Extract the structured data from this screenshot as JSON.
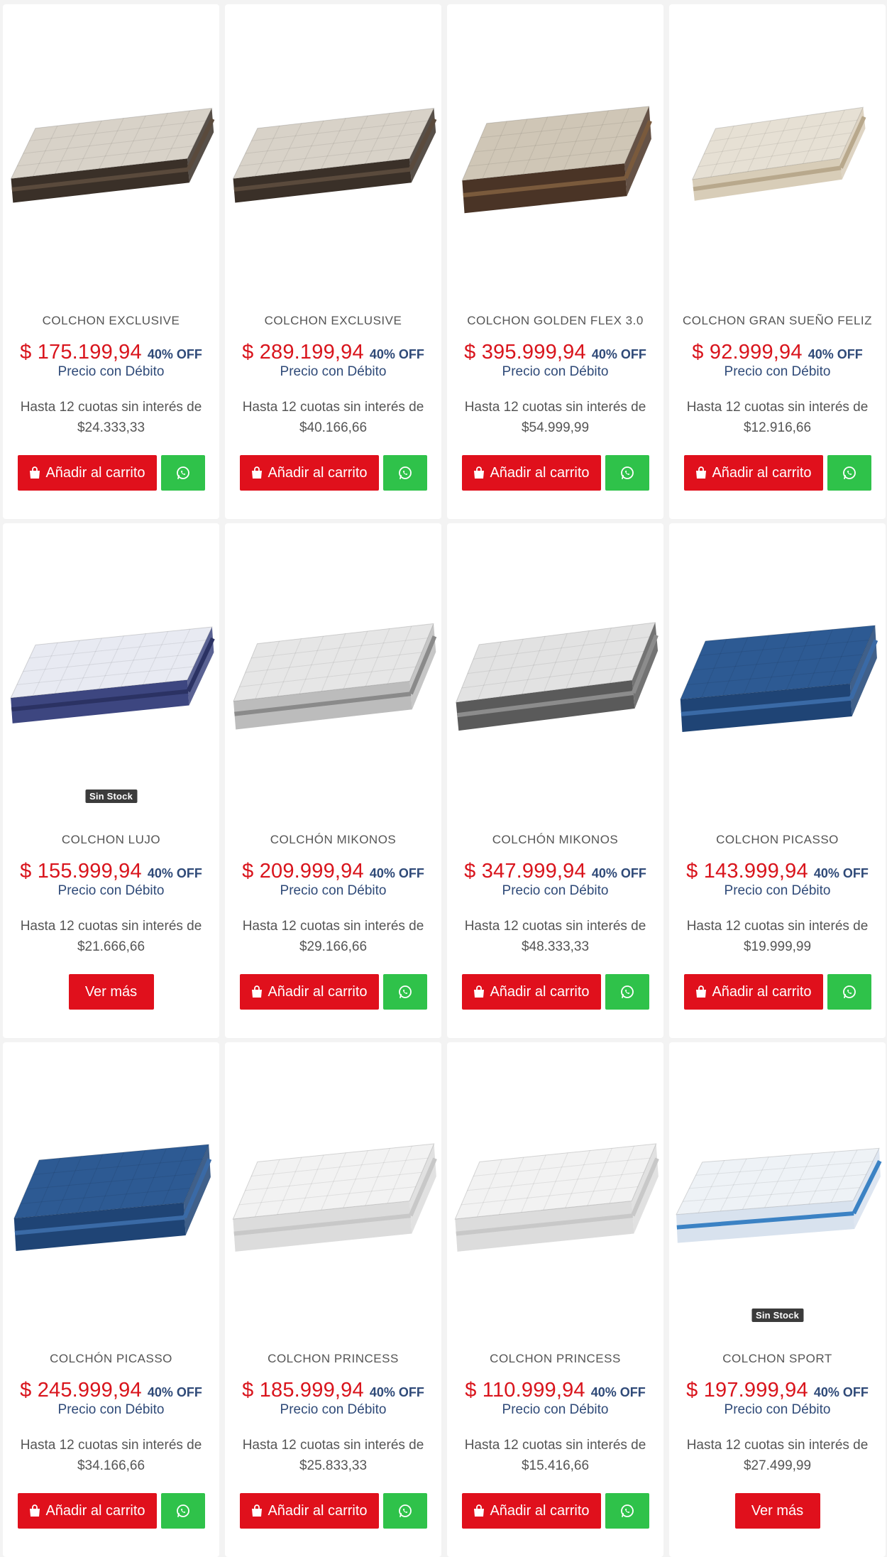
{
  "products": [
    {
      "name": "COLCHON EXCLUSIVE",
      "price": "$ 175.199,94",
      "off": "40% OFF",
      "debit": "Precio con Débito",
      "inst1": "Hasta 12 cuotas sin interés de",
      "inst2": "$24.333,33",
      "stock": "",
      "cart": "Añadir al carrito",
      "more": "",
      "img": "dark-quilted"
    },
    {
      "name": "COLCHON EXCLUSIVE",
      "price": "$ 289.199,94",
      "off": "40% OFF",
      "debit": "Precio con Débito",
      "inst1": "Hasta 12 cuotas sin interés de",
      "inst2": "$40.166,66",
      "stock": "",
      "cart": "Añadir al carrito",
      "more": "",
      "img": "dark-quilted"
    },
    {
      "name": "COLCHON GOLDEN FLEX 3.0",
      "price": "$ 395.999,94",
      "off": "40% OFF",
      "debit": "Precio con Débito",
      "inst1": "Hasta 12 cuotas sin interés de",
      "inst2": "$54.999,99",
      "stock": "",
      "cart": "Añadir al carrito",
      "more": "",
      "img": "brown-pillow"
    },
    {
      "name": "COLCHON GRAN SUEÑO FELIZ",
      "price": "$ 92.999,94",
      "off": "40% OFF",
      "debit": "Precio con Débito",
      "inst1": "Hasta 12 cuotas sin interés de",
      "inst2": "$12.916,66",
      "stock": "",
      "cart": "Añadir al carrito",
      "more": "",
      "img": "beige-single"
    },
    {
      "name": "COLCHON LUJO",
      "price": "$ 155.999,94",
      "off": "40% OFF",
      "debit": "Precio con Débito",
      "inst1": "Hasta 12 cuotas sin interés de",
      "inst2": "$21.666,66",
      "stock": "Sin Stock",
      "cart": "",
      "more": "Ver más",
      "img": "navy-white"
    },
    {
      "name": "COLCHÓN MIKONOS",
      "price": "$ 209.999,94",
      "off": "40% OFF",
      "debit": "Precio con Débito",
      "inst1": "Hasta 12 cuotas sin interés de",
      "inst2": "$29.166,66",
      "stock": "",
      "cart": "Añadir al carrito",
      "more": "",
      "img": "gray-stripe"
    },
    {
      "name": "COLCHÓN MIKONOS",
      "price": "$ 347.999,94",
      "off": "40% OFF",
      "debit": "Precio con Débito",
      "inst1": "Hasta 12 cuotas sin interés de",
      "inst2": "$48.333,33",
      "stock": "",
      "cart": "Añadir al carrito",
      "more": "",
      "img": "gray-dark-stripe"
    },
    {
      "name": "COLCHON PICASSO",
      "price": "$ 143.999,94",
      "off": "40% OFF",
      "debit": "Precio con Débito",
      "inst1": "Hasta 12 cuotas sin interés de",
      "inst2": "$19.999,99",
      "stock": "",
      "cart": "Añadir al carrito",
      "more": "",
      "img": "blue-thick"
    },
    {
      "name": "COLCHÓN PICASSO",
      "price": "$ 245.999,94",
      "off": "40% OFF",
      "debit": "Precio con Débito",
      "inst1": "Hasta 12 cuotas sin interés de",
      "inst2": "$34.166,66",
      "stock": "",
      "cart": "Añadir al carrito",
      "more": "",
      "img": "blue-thick"
    },
    {
      "name": "COLCHON PRINCESS",
      "price": "$ 185.999,94",
      "off": "40% OFF",
      "debit": "Precio con Débito",
      "inst1": "Hasta 12 cuotas sin interés de",
      "inst2": "$25.833,33",
      "stock": "",
      "cart": "Añadir al carrito",
      "more": "",
      "img": "white-thick"
    },
    {
      "name": "COLCHON PRINCESS",
      "price": "$ 110.999,94",
      "off": "40% OFF",
      "debit": "Precio con Débito",
      "inst1": "Hasta 12 cuotas sin interés de",
      "inst2": "$15.416,66",
      "stock": "",
      "cart": "Añadir al carrito",
      "more": "",
      "img": "white-thick"
    },
    {
      "name": "COLCHON SPORT",
      "price": "$ 197.999,94",
      "off": "40% OFF",
      "debit": "Precio con Débito",
      "inst1": "Hasta 12 cuotas sin interés de",
      "inst2": "$27.499,99",
      "stock": "Sin Stock",
      "cart": "",
      "more": "Ver más",
      "img": "white-blue-band"
    }
  ],
  "colors": {
    "price": "#d9141c",
    "off": "#2f4a78",
    "button_red": "#e0101c",
    "button_green": "#2fc24a",
    "badge": "#3b3b3b"
  },
  "icons": {
    "cart": "shopping-bag-icon",
    "whatsapp": "whatsapp-icon"
  }
}
